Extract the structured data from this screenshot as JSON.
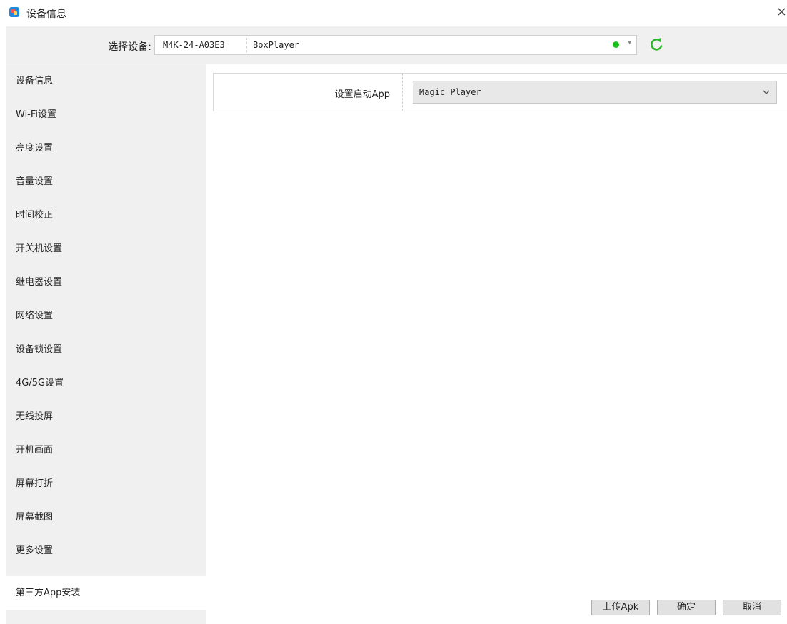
{
  "window": {
    "title": "设备信息",
    "close": "×"
  },
  "device_bar": {
    "label": "选择设备:",
    "device_id": "M4K-24-A03E3",
    "device_name": "BoxPlayer",
    "status_color": "#19c019",
    "dropdown_icon": "▼"
  },
  "sidebar": {
    "items": [
      {
        "label": "设备信息"
      },
      {
        "label": "Wi-Fi设置"
      },
      {
        "label": "亮度设置"
      },
      {
        "label": "音量设置"
      },
      {
        "label": "时间校正"
      },
      {
        "label": "开关机设置"
      },
      {
        "label": "继电器设置"
      },
      {
        "label": "网络设置"
      },
      {
        "label": "设备锁设置"
      },
      {
        "label": "4G/5G设置"
      },
      {
        "label": "无线投屏"
      },
      {
        "label": "开机画面"
      },
      {
        "label": "屏幕打折"
      },
      {
        "label": "屏幕截图"
      },
      {
        "label": "更多设置"
      },
      {
        "label": "第三方App安装"
      }
    ],
    "active_index": 15
  },
  "settings": {
    "startup_app_label": "设置启动App",
    "startup_app_value": "Magic Player"
  },
  "footer": {
    "upload_label": "上传Apk",
    "ok_label": "确定",
    "cancel_label": "取消"
  },
  "colors": {
    "accent_green": "#2db42d",
    "sidebar_bg": "#f0f0f0"
  }
}
